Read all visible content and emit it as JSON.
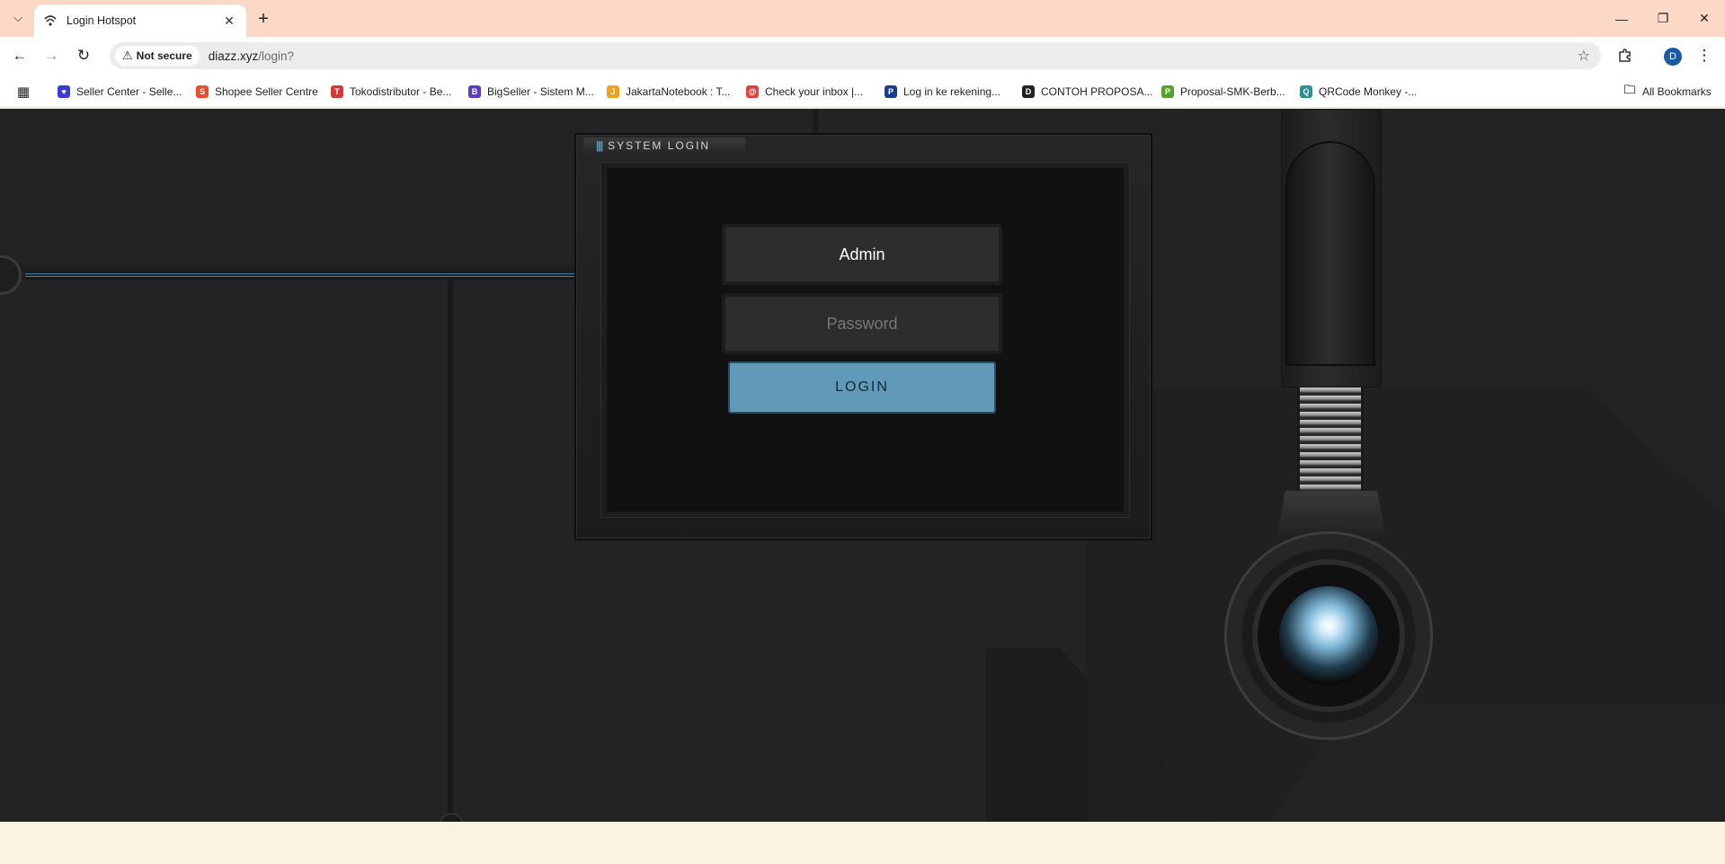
{
  "browser": {
    "tab": {
      "title": "Login Hotspot"
    },
    "window_controls": {
      "minimize": "—",
      "restore": "❐",
      "close": "✕"
    },
    "security_chip": "Not secure",
    "url_host": "diazz.xyz",
    "url_path": "/login?",
    "avatar_letter": "D",
    "bookmarks": [
      {
        "label": "Seller Center - Selle...",
        "color": "#3b3bd6"
      },
      {
        "label": "Shopee Seller Centre",
        "color": "#ee4d2d"
      },
      {
        "label": "Tokodistributor - Be...",
        "color": "#d23a3a"
      },
      {
        "label": "BigSeller - Sistem M...",
        "color": "#5b3cc4"
      },
      {
        "label": "JakartaNotebook : T...",
        "color": "#f0a020"
      },
      {
        "label": "Check your inbox |...",
        "color": "#e04040"
      },
      {
        "label": "Log in ke rekening...",
        "color": "#1b3d8f"
      },
      {
        "label": "CONTOH PROPOSA...",
        "color": "#222222"
      },
      {
        "label": "Proposal-SMK-Berb...",
        "color": "#5aa02c"
      },
      {
        "label": "QRCode Monkey -...",
        "color": "#2a8f8f"
      }
    ],
    "all_bookmarks": "All Bookmarks"
  },
  "login": {
    "header": "SYSTEM LOGIN",
    "username_value": "Admin",
    "password_placeholder": "Password",
    "button_label": "LOGIN"
  },
  "colors": {
    "tabbar_bg": "#fcd9c6",
    "accent_button": "#619ab8",
    "page_bg": "#232324",
    "footer_bg": "#faf3e1"
  }
}
